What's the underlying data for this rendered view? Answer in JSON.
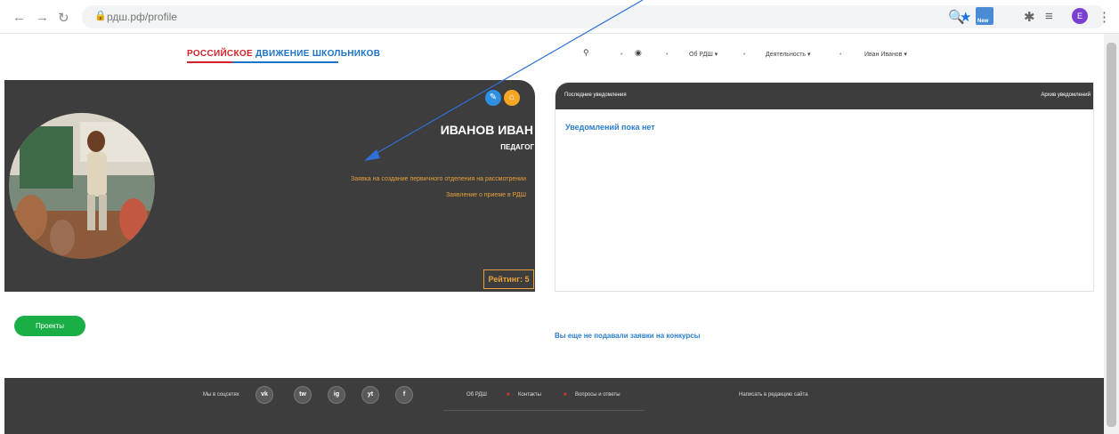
{
  "browser": {
    "url": "рдш.рф/profile",
    "new_badge": "New",
    "profile_initial": "E"
  },
  "header": {
    "logo_part1": "РОССИЙСКОЕ",
    "logo_part2": "ДВИЖЕНИЕ ШКОЛЬНИКОВ",
    "nav_about": "Об РДШ ▾",
    "nav_activity": "Деятельность ▾",
    "nav_user": "Иван Иванов ▾"
  },
  "profile": {
    "name": "ИВАНОВ ИВАН",
    "role": "ПЕДАГОГ",
    "application_status": "Заявка на создание первичного отделения на рассмотрении",
    "rdsh_application": "Заявление о приеме в РДШ",
    "rating": "Рейтинг: 5"
  },
  "notifications": {
    "title": "Последние уведомления",
    "archive": "Архив уведомлений",
    "empty": "Уведомлений пока нет"
  },
  "main": {
    "projects_button": "Проекты",
    "no_applications": "Вы еще не подавали заявки на конкурсы"
  },
  "footer": {
    "social_label": "Мы в соцсетях",
    "social": [
      "vk",
      "tw",
      "ig",
      "yt",
      "f"
    ],
    "about": "Об РДШ",
    "contacts": "Контакты",
    "faq": "Вопросы и ответы",
    "write_editor": "Написать в редакцию сайта"
  },
  "colors": {
    "accent_blue": "#2a7fd0",
    "accent_orange": "#e6a23c",
    "green": "#1aae46",
    "dark_panel": "#3d3d3d"
  }
}
